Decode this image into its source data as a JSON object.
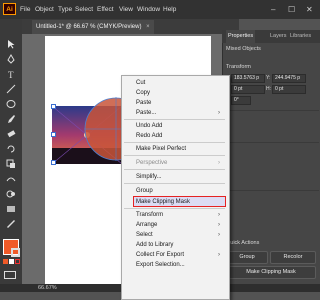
{
  "app": {
    "logo": "Ai"
  },
  "menubar": {
    "items": [
      "File",
      "Object",
      "Type",
      "Select",
      "Effect",
      "View",
      "Window",
      "Help"
    ]
  },
  "window_controls": {
    "minimize": "–",
    "maximize": "☐",
    "close": "✕"
  },
  "document": {
    "tab_title": "Untitled-1* @ 66.67 % (CMYK/Preview)",
    "tab_close": "×"
  },
  "statusbar": {
    "zoom": "66.67%"
  },
  "panel": {
    "tabs": [
      "Properties",
      "Layers",
      "Libraries"
    ],
    "selection": "Mixed Objects",
    "transform": {
      "label": "Transform",
      "x_label": "X:",
      "x": "183.5763 p",
      "y_label": "Y:",
      "y": "244.9475 p",
      "w_label": "W:",
      "w": "0 pt",
      "h_label": "H:",
      "h": "0 pt",
      "angle": "0°"
    },
    "quick_actions_label": "Quick Actions",
    "buttons": {
      "group": "Group",
      "recolor": "Recolor",
      "make_clipping_mask": "Make Clipping Mask"
    }
  },
  "context_menu": {
    "items": [
      {
        "label": "Cut"
      },
      {
        "label": "Copy"
      },
      {
        "label": "Paste"
      },
      {
        "label": "Paste...",
        "submenu": true
      },
      {
        "label": "Undo Add"
      },
      {
        "label": "Redo Add"
      },
      {
        "label": "Make Pixel Perfect"
      },
      {
        "label": "Perspective",
        "submenu": true,
        "disabled": true
      },
      {
        "label": "Simplify..."
      },
      {
        "label": "Group"
      },
      {
        "label": "Make Clipping Mask",
        "highlighted": true
      },
      {
        "label": "Transform",
        "submenu": true
      },
      {
        "label": "Arrange",
        "submenu": true
      },
      {
        "label": "Select",
        "submenu": true
      },
      {
        "label": "Add to Library"
      },
      {
        "label": "Collect For Export",
        "submenu": true
      },
      {
        "label": "Export Selection..."
      }
    ],
    "submenu_arrow": "›"
  },
  "colors": {
    "accent_fill": "#f05a28",
    "highlight_border": "#e52222"
  }
}
